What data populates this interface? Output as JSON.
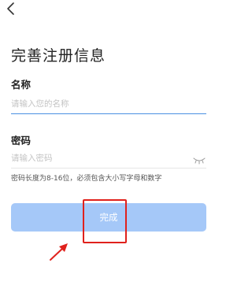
{
  "header": {
    "back_icon": "chevron-left-icon",
    "title": "完善注册信息"
  },
  "form": {
    "name": {
      "label": "名称",
      "placeholder": "请输入您的名称",
      "value": ""
    },
    "password": {
      "label": "密码",
      "placeholder": "请输入密码",
      "value": "",
      "toggle_icon": "eye-closed-icon"
    },
    "password_hint": "密码长度为8-16位，必须包含大小写字母和数字",
    "submit_label": "完成"
  },
  "colors": {
    "active_underline": "#4a90e2",
    "inactive_underline": "#e6e6e6",
    "button_disabled": "#a5c8f8",
    "annotation_red": "#e0211c"
  }
}
